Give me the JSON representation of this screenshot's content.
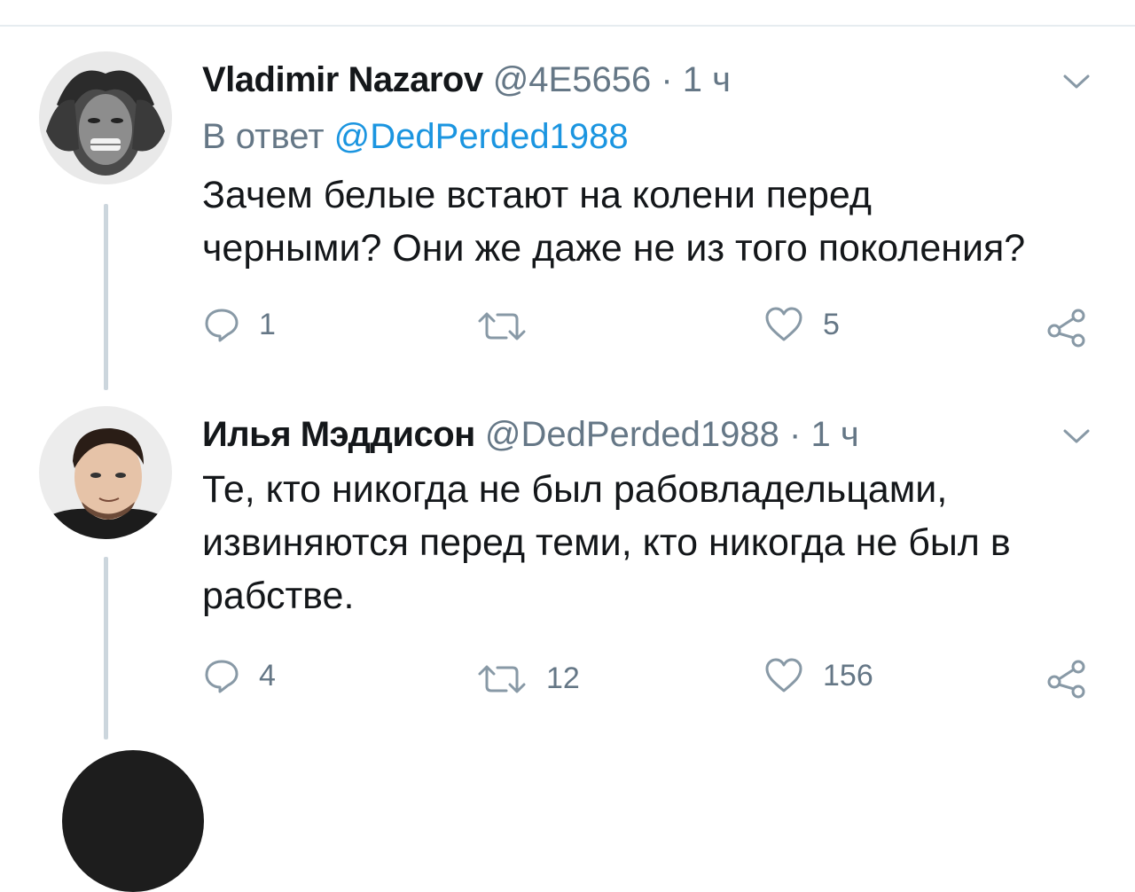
{
  "tweets": [
    {
      "author_name": "Vladimir Nazarov",
      "handle": "@4E5656",
      "separator": "·",
      "time": "1 ч",
      "reply_prefix": "В ответ",
      "reply_mention": "@DedPerded1988",
      "text_line1": "Зачем белые встают на колени перед",
      "text_line2": "черными? Они же даже не из того поколения?",
      "replies": "1",
      "retweets": "",
      "likes": "5"
    },
    {
      "author_name": "Илья Мэддисон",
      "handle": "@DedPerded1988",
      "separator": "·",
      "time": "1 ч",
      "text_line1": "Те, кто никогда не был рабовладельцами,",
      "text_line2": "извиняются перед теми, кто никогда не был в",
      "text_line3": "рабстве.",
      "replies": "4",
      "retweets": "12",
      "likes": "156"
    }
  ],
  "colors": {
    "text": "#14171a",
    "secondary": "#657786",
    "link": "#1b95e0",
    "thread_line": "#ccd6dd"
  },
  "icons": [
    "reply-icon",
    "retweet-icon",
    "like-icon",
    "share-icon",
    "chevron-down-icon"
  ]
}
